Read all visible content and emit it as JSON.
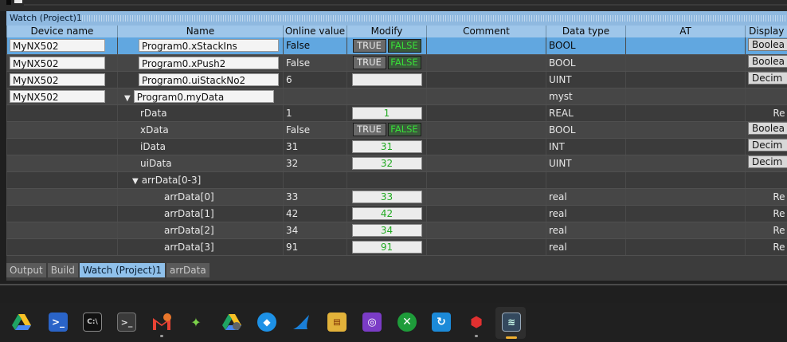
{
  "window": {
    "title": "Watch (Project)1"
  },
  "columns": {
    "device": "Device name",
    "name": "Name",
    "online": "Online value",
    "modify": "Modify",
    "comment": "Comment",
    "dtype": "Data type",
    "at": "AT",
    "display": "Display"
  },
  "rows": [
    {
      "device": "MyNX502",
      "name": "Program0.xStackIns",
      "online": "False",
      "dtype": "BOOL",
      "display": "Boolea"
    },
    {
      "device": "MyNX502",
      "name": "Program0.xPush2",
      "online": "False",
      "dtype": "BOOL",
      "display": "Boolea"
    },
    {
      "device": "MyNX502",
      "name": "Program0.uiStackNo2",
      "online": "6",
      "dtype": "UINT",
      "display": "Decim"
    },
    {
      "device": "MyNX502",
      "name": "Program0.myData",
      "online": "",
      "dtype": "myst",
      "display": ""
    },
    {
      "device": "",
      "name": "rData",
      "online": "1",
      "modify": "1",
      "dtype": "REAL",
      "display": "Re"
    },
    {
      "device": "",
      "name": "xData",
      "online": "False",
      "dtype": "BOOL",
      "display": "Boolea"
    },
    {
      "device": "",
      "name": "iData",
      "online": "31",
      "modify": "31",
      "dtype": "INT",
      "display": "Decim"
    },
    {
      "device": "",
      "name": "uiData",
      "online": "32",
      "modify": "32",
      "dtype": "UINT",
      "display": "Decim"
    },
    {
      "device": "",
      "name": "arrData[0-3]",
      "online": "",
      "dtype": "",
      "display": ""
    },
    {
      "device": "",
      "name": "arrData[0]",
      "online": "33",
      "modify": "33",
      "dtype": "real",
      "display": "Re"
    },
    {
      "device": "",
      "name": "arrData[1]",
      "online": "42",
      "modify": "42",
      "dtype": "real",
      "display": "Re"
    },
    {
      "device": "",
      "name": "arrData[2]",
      "online": "34",
      "modify": "34",
      "dtype": "real",
      "display": "Re"
    },
    {
      "device": "",
      "name": "arrData[3]",
      "online": "91",
      "modify": "91",
      "dtype": "real",
      "display": "Re"
    }
  ],
  "modify_labels": {
    "true": "TRUE",
    "false": "FALSE"
  },
  "tabs": [
    "Output",
    "Build",
    "Watch (Project)1",
    "arrData"
  ],
  "taskbar": [
    "google-drive-icon",
    "powershell-icon",
    "cmd-icon",
    "terminal-icon",
    "gmail-icon",
    "circuit-icon",
    "drive-color-icon",
    "docker-icon",
    "sharkfin-icon",
    "sysmac-icon",
    "ring-app-icon",
    "xbox-icon",
    "refresh-app-icon",
    "robot-app-icon",
    "sysmac-studio-icon"
  ],
  "colors": {
    "selection": "#61a7e0",
    "header": "#9ec6ea",
    "modify_green": "#22aa22",
    "false_green": "#38e038",
    "active_tab": "#8fc0ea"
  }
}
